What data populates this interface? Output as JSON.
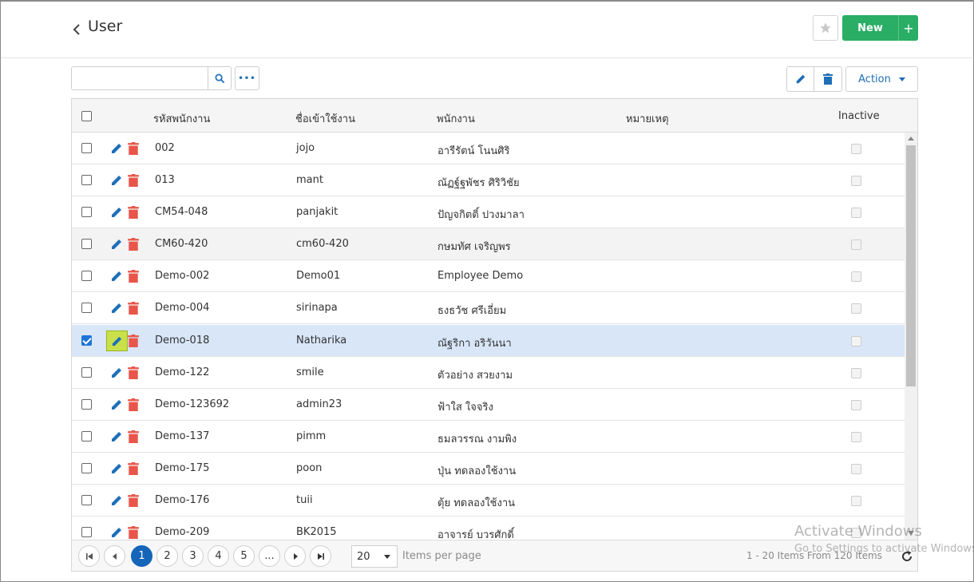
{
  "header": {
    "title": "User",
    "new_label": "New",
    "new_plus": "+"
  },
  "toolbar": {
    "search_value": "",
    "more_label": "•••",
    "action_label": "Action"
  },
  "colors": {
    "primary": "#1e6fb8",
    "success": "#2aae65",
    "danger": "#e8564b",
    "selected_row": "#d8e6f8",
    "highlight": "#c8e04a"
  },
  "columns": {
    "code": "รหัสพนักงาน",
    "username": "ชื่อเข้าใช้งาน",
    "employee": "พนักงาน",
    "remark": "หมายเหตุ",
    "inactive": "Inactive"
  },
  "rows": [
    {
      "code": "002",
      "username": "jojo",
      "employee": "อารีรัตน์ โนนศิริ",
      "remark": "",
      "inactive": false,
      "checked": false
    },
    {
      "code": "013",
      "username": "mant",
      "employee": "ณัฏฐ์ฐพัชร ศิริวิชัย",
      "remark": "",
      "inactive": false,
      "checked": false
    },
    {
      "code": "CM54-048",
      "username": "panjakit",
      "employee": "ปัญจกิตติ์ ปวงมาลา",
      "remark": "",
      "inactive": false,
      "checked": false
    },
    {
      "code": "CM60-420",
      "username": "cm60-420",
      "employee": "กษมทัศ เจริญพร",
      "remark": "",
      "inactive": false,
      "checked": false
    },
    {
      "code": "Demo-002",
      "username": "Demo01",
      "employee": "Employee Demo",
      "remark": "",
      "inactive": false,
      "checked": false
    },
    {
      "code": "Demo-004",
      "username": "sirinapa",
      "employee": "ธงธวัช ศรีเอี่ยม",
      "remark": "",
      "inactive": false,
      "checked": false
    },
    {
      "code": "Demo-018",
      "username": "Natharika",
      "employee": "ณัฐริกา อริวันนา",
      "remark": "",
      "inactive": false,
      "checked": true
    },
    {
      "code": "Demo-122",
      "username": "smile",
      "employee": "ตัวอย่าง สวยงาม",
      "remark": "",
      "inactive": false,
      "checked": false
    },
    {
      "code": "Demo-123692",
      "username": "admin23",
      "employee": "ฟ้าใส ใจจริง",
      "remark": "",
      "inactive": false,
      "checked": false
    },
    {
      "code": "Demo-137",
      "username": "pimm",
      "employee": "ธมลวรรณ งามพิง",
      "remark": "",
      "inactive": false,
      "checked": false
    },
    {
      "code": "Demo-175",
      "username": "poon",
      "employee": "ปุ่น ทดลองใช้งาน",
      "remark": "",
      "inactive": false,
      "checked": false
    },
    {
      "code": "Demo-176",
      "username": "tuii",
      "employee": "ตุ้ย ทดลองใช้งาน",
      "remark": "",
      "inactive": false,
      "checked": false
    },
    {
      "code": "Demo-209",
      "username": "BK2015",
      "employee": "อาจารย์ บวรศักดิ์",
      "remark": "",
      "inactive": false,
      "checked": false
    }
  ],
  "pager": {
    "pages": [
      "1",
      "2",
      "3",
      "4",
      "5",
      "..."
    ],
    "current": "1",
    "page_size": "20",
    "items_per_page": "Items per page",
    "summary": "1 - 20 Items From 120 Items"
  },
  "watermark": {
    "line1": "Activate Windows",
    "line2": "Go to Settings to activate Windows."
  }
}
